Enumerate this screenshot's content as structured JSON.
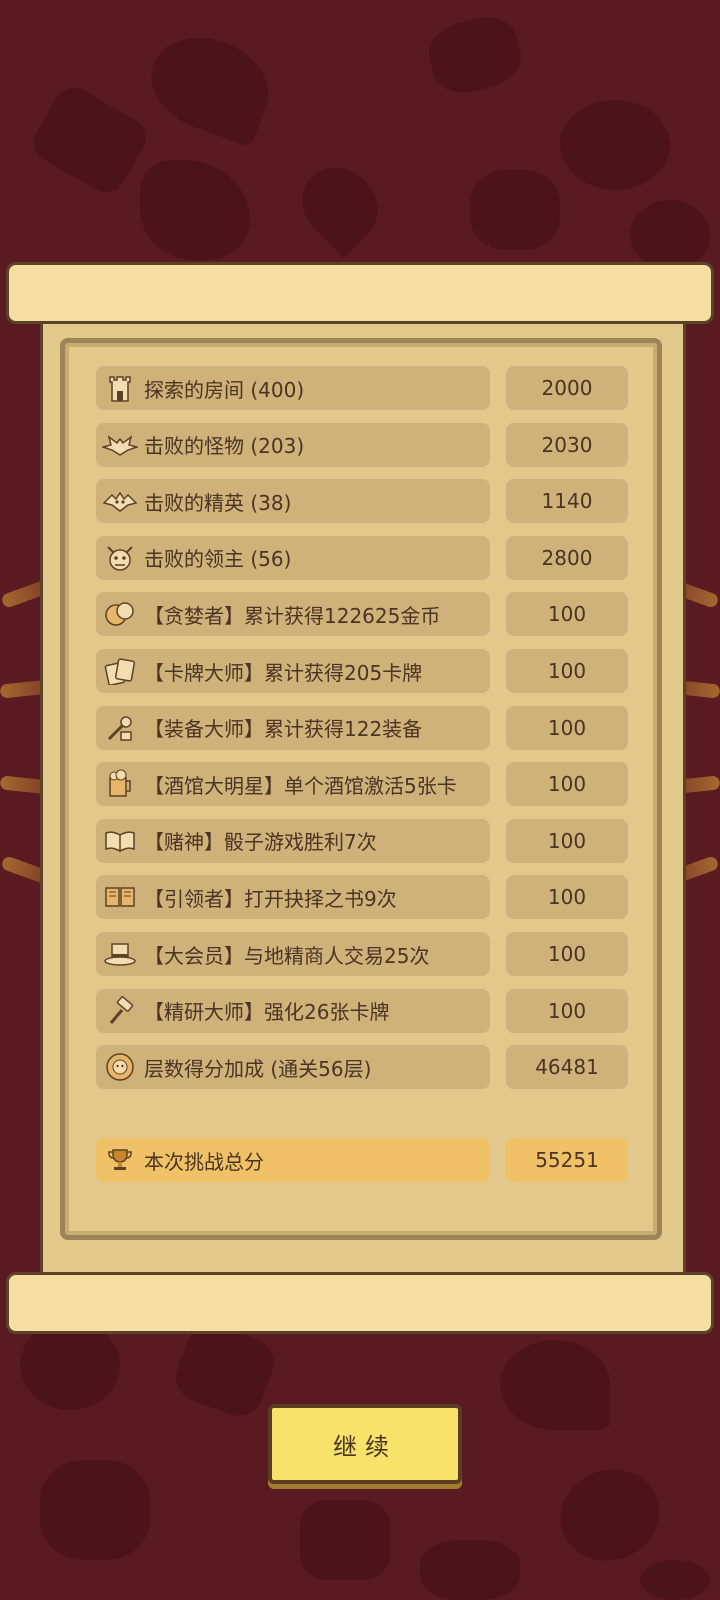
{
  "rows": [
    {
      "icon": "castle-tower-icon",
      "label": "探索的房间 (400)",
      "value": "2000"
    },
    {
      "icon": "bat-icon",
      "label": "击败的怪物 (203)",
      "value": "2030"
    },
    {
      "icon": "winged-demon-icon",
      "label": "击败的精英 (38)",
      "value": "1140"
    },
    {
      "icon": "horned-boss-icon",
      "label": "击败的领主 (56)",
      "value": "2800"
    },
    {
      "icon": "gold-coins-icon",
      "label": "【贪婪者】累计获得122625金币",
      "value": "100"
    },
    {
      "icon": "cards-icon",
      "label": "【卡牌大师】累计获得205卡牌",
      "value": "100"
    },
    {
      "icon": "equipment-icon",
      "label": "【装备大师】累计获得122装备",
      "value": "100"
    },
    {
      "icon": "beer-mug-icon",
      "label": "【酒馆大明星】单个酒馆激活5张卡",
      "value": "100"
    },
    {
      "icon": "open-book-icon",
      "label": "【赌神】骰子游戏胜利7次",
      "value": "100"
    },
    {
      "icon": "book-icon",
      "label": "【引领者】打开抉择之书9次",
      "value": "100"
    },
    {
      "icon": "top-hat-icon",
      "label": "【大会员】与地精商人交易25次",
      "value": "100"
    },
    {
      "icon": "hammer-icon",
      "label": "【精研大师】强化26张卡牌",
      "value": "100"
    },
    {
      "icon": "lion-emblem-icon",
      "label": "层数得分加成 (通关56层)",
      "value": "46481"
    }
  ],
  "total": {
    "icon": "trophy-icon",
    "label": "本次挑战总分",
    "value": "55251"
  },
  "continue_label": "继续",
  "colors": {
    "background": "#5a1a22",
    "parchment": "#e2c88b",
    "row": "#cfb17a",
    "total_row": "#f0c166",
    "button": "#f7e26a",
    "text": "#4a3422"
  }
}
